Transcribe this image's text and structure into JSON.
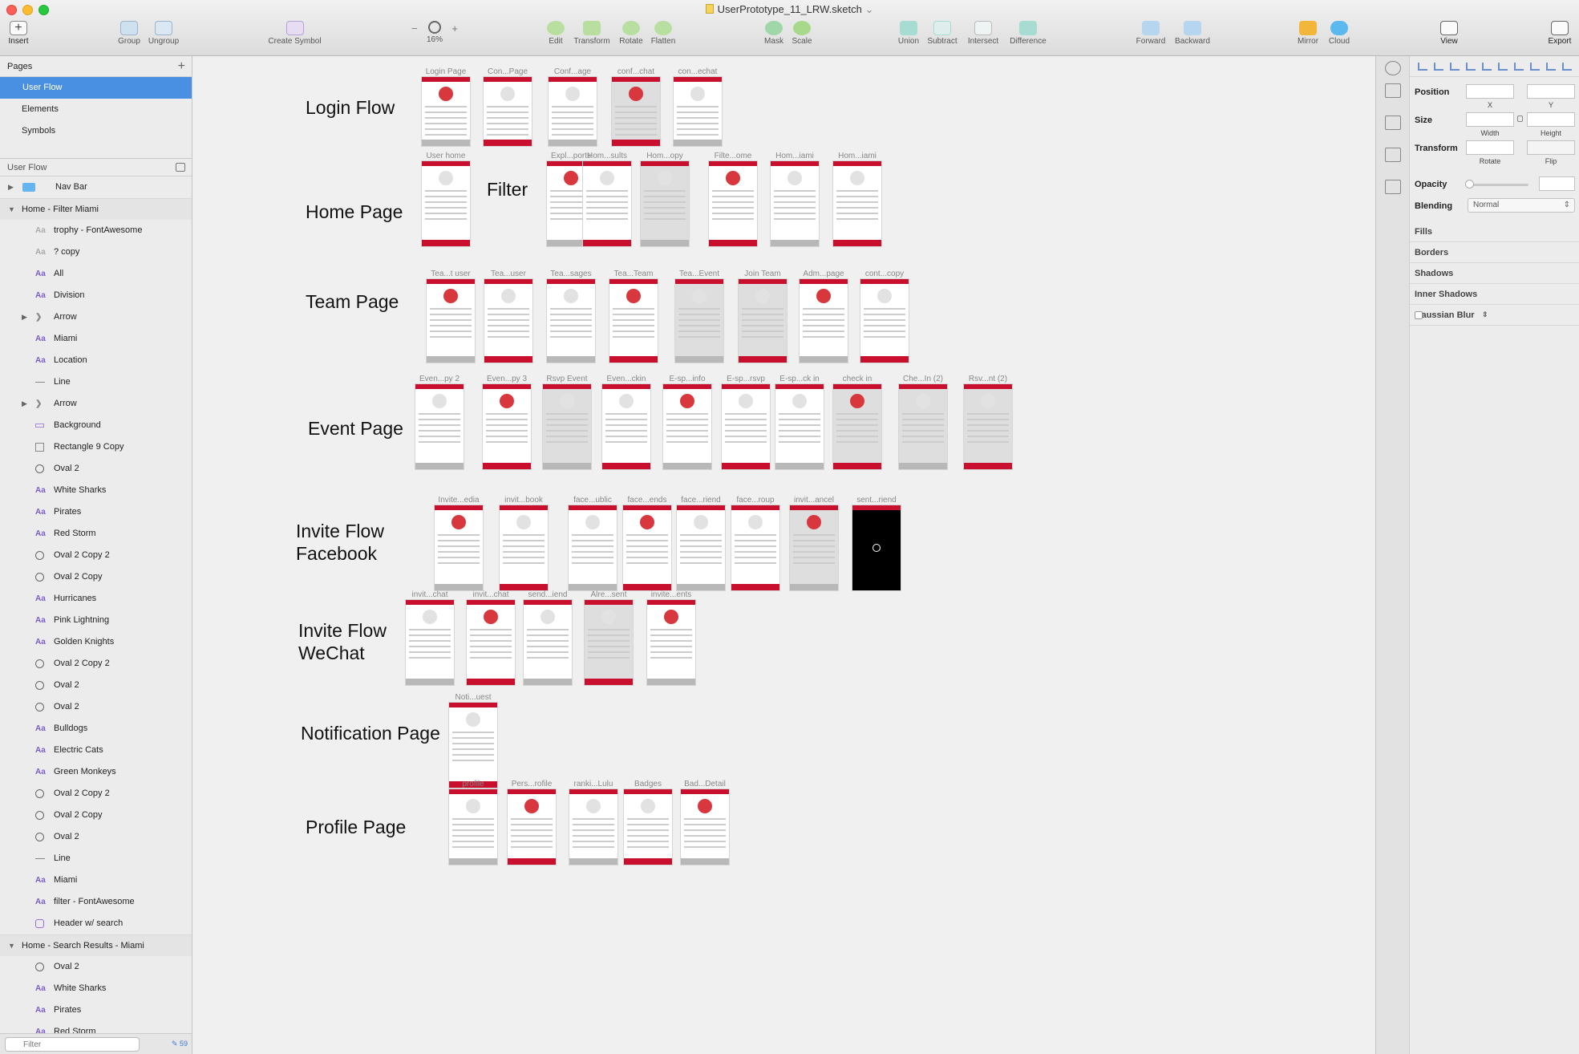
{
  "window": {
    "title": "UserPrototype_11_LRW.sketch",
    "title_chevron": "⌄"
  },
  "toolbar": {
    "insert": "Insert",
    "group": "Group",
    "ungroup": "Ungroup",
    "create_symbol": "Create Symbol",
    "zoom_minus": "−",
    "zoom_plus": "+",
    "zoom": "16%",
    "edit": "Edit",
    "transform": "Transform",
    "rotate": "Rotate",
    "flatten": "Flatten",
    "mask": "Mask",
    "scale": "Scale",
    "union": "Union",
    "subtract": "Subtract",
    "intersect": "Intersect",
    "difference": "Difference",
    "forward": "Forward",
    "backward": "Backward",
    "mirror": "Mirror",
    "cloud": "Cloud",
    "view": "View",
    "export": "Export"
  },
  "pages": {
    "header": "Pages",
    "add": "+",
    "items": [
      {
        "label": "User Flow",
        "selected": true
      },
      {
        "label": "Elements"
      },
      {
        "label": "Symbols"
      }
    ]
  },
  "layers": {
    "header": "User Flow",
    "items": [
      {
        "type": "folder",
        "label": "Nav Bar",
        "tw": "▶",
        "level": 0
      },
      {
        "type": "group",
        "label": "Home - Filter Miami",
        "tw": "▼",
        "level": 0
      },
      {
        "type": "text",
        "label": "trophy - FontAwesome",
        "grey": true
      },
      {
        "type": "text",
        "label": "? copy",
        "grey": true
      },
      {
        "type": "text",
        "label": "All"
      },
      {
        "type": "text",
        "label": "Division"
      },
      {
        "type": "chev",
        "label": "Arrow"
      },
      {
        "type": "text",
        "label": "Miami"
      },
      {
        "type": "text",
        "label": "Location"
      },
      {
        "type": "line",
        "label": "Line"
      },
      {
        "type": "chev",
        "label": "Arrow"
      },
      {
        "type": "bg",
        "label": "Background"
      },
      {
        "type": "rect",
        "label": "Rectangle 9 Copy"
      },
      {
        "type": "oval",
        "label": "Oval 2"
      },
      {
        "type": "text",
        "label": "White Sharks"
      },
      {
        "type": "text",
        "label": "Pirates"
      },
      {
        "type": "text",
        "label": "Red Storm"
      },
      {
        "type": "oval",
        "label": "Oval 2 Copy 2"
      },
      {
        "type": "oval",
        "label": "Oval 2 Copy"
      },
      {
        "type": "text",
        "label": "Hurricanes"
      },
      {
        "type": "text",
        "label": "Pink Lightning"
      },
      {
        "type": "text",
        "label": "Golden Knights"
      },
      {
        "type": "oval",
        "label": "Oval 2 Copy 2"
      },
      {
        "type": "oval",
        "label": "Oval 2"
      },
      {
        "type": "oval",
        "label": "Oval 2"
      },
      {
        "type": "text",
        "label": "Bulldogs"
      },
      {
        "type": "text",
        "label": "Electric Cats"
      },
      {
        "type": "text",
        "label": "Green Monkeys"
      },
      {
        "type": "oval",
        "label": "Oval 2 Copy 2"
      },
      {
        "type": "oval",
        "label": "Oval 2 Copy"
      },
      {
        "type": "oval",
        "label": "Oval 2"
      },
      {
        "type": "line",
        "label": "Line"
      },
      {
        "type": "text",
        "label": "Miami"
      },
      {
        "type": "text",
        "label": "filter - FontAwesome"
      },
      {
        "type": "symbol",
        "label": "Header w/ search"
      },
      {
        "type": "group",
        "label": "Home - Search Results - Miami",
        "tw": "▼",
        "level": 0
      },
      {
        "type": "oval",
        "label": "Oval 2"
      },
      {
        "type": "text",
        "label": "White Sharks"
      },
      {
        "type": "text",
        "label": "Pirates"
      },
      {
        "type": "text",
        "label": "Red Storm"
      }
    ],
    "filter_placeholder": "Filter",
    "count": "59"
  },
  "canvas": {
    "sections": [
      {
        "id": "login",
        "title": "Login Flow"
      },
      {
        "id": "home",
        "title": "Home Page"
      },
      {
        "id": "filter",
        "title": "Filter"
      },
      {
        "id": "team",
        "title": "Team Page"
      },
      {
        "id": "event",
        "title": "Event Page"
      },
      {
        "id": "invfb",
        "title": "Invite Flow\nFacebook"
      },
      {
        "id": "invwc",
        "title": "Invite Flow\nWeChat"
      },
      {
        "id": "notif",
        "title": "Notification Page"
      },
      {
        "id": "profile",
        "title": "Profile Page"
      }
    ],
    "artboards": [
      "Login Page",
      "Con...Page",
      "Conf...age",
      "conf...chat",
      "con...echat",
      "User home",
      "Expl...ports",
      "Hom...sults",
      "Hom...opy",
      "Filte...ome",
      "Hom...iami",
      "Hom...iami",
      "Tea...t user",
      "Tea...user",
      "Tea...sages",
      "Tea...Team",
      "Tea...Event",
      "Join Team",
      "Adm...page",
      "cont...copy",
      "Even...py 2",
      "Even...py 3",
      "Rsvp Event",
      "Even...ckin",
      "E-sp...info",
      "E-sp...rsvp",
      "E-sp...ck in",
      "check in",
      "Che...In (2)",
      "Rsv...nt (2)",
      "Invite...edia",
      "invit...book",
      "face...ublic",
      "face...ends",
      "face...riend",
      "face...roup",
      "invit...ancel",
      "sent...riend",
      "invit...chat",
      "invit...chat",
      "send...iend",
      "Alre...sent",
      "invite...ents",
      "Noti...uest",
      "profile",
      "Pers...rofile",
      "ranki...Lulu",
      "Badges",
      "Bad...Detail"
    ]
  },
  "inspector": {
    "position": "Position",
    "x": "X",
    "y": "Y",
    "size": "Size",
    "width": "Width",
    "height": "Height",
    "transform": "Transform",
    "rotate": "Rotate",
    "flip": "Flip",
    "opacity": "Opacity",
    "blending": "Blending",
    "blending_value": "Normal",
    "fills": "Fills",
    "borders": "Borders",
    "shadows": "Shadows",
    "inner_shadows": "Inner Shadows",
    "gaussian_blur": "Gaussian Blur"
  },
  "colors": {
    "accent": "#4a90e2",
    "brand_red": "#c8102e"
  }
}
